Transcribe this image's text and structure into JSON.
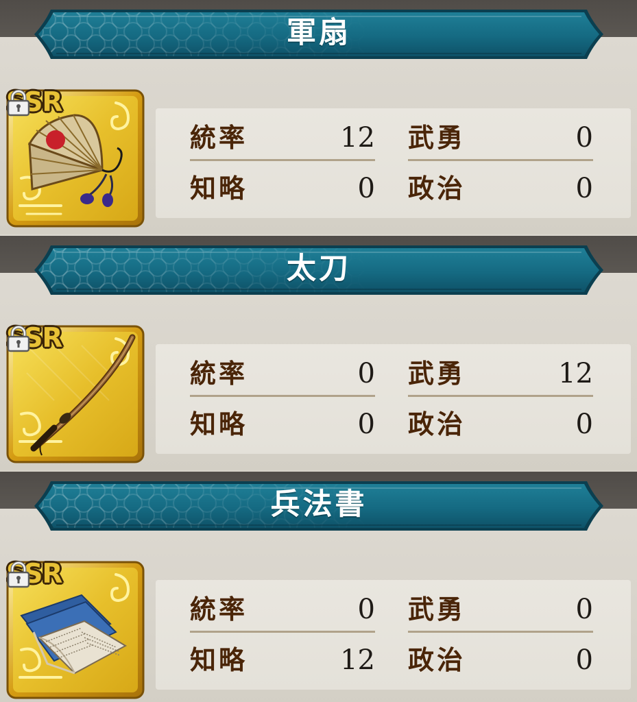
{
  "colors": {
    "banner": "#176f86",
    "banner_dark": "#0d4f64",
    "card_gold": "#e8c431",
    "label_brown": "#4a2508"
  },
  "items": [
    {
      "name": "軍扇",
      "rarity": "SSR",
      "icon": "war-fan-icon",
      "stats": {
        "leadership": {
          "label": "統率",
          "value": "12"
        },
        "valor": {
          "label": "武勇",
          "value": "0"
        },
        "intellect": {
          "label": "知略",
          "value": "0"
        },
        "politics": {
          "label": "政治",
          "value": "0"
        }
      }
    },
    {
      "name": "太刀",
      "rarity": "SSR",
      "icon": "tachi-sword-icon",
      "stats": {
        "leadership": {
          "label": "統率",
          "value": "0"
        },
        "valor": {
          "label": "武勇",
          "value": "12"
        },
        "intellect": {
          "label": "知略",
          "value": "0"
        },
        "politics": {
          "label": "政治",
          "value": "0"
        }
      }
    },
    {
      "name": "兵法書",
      "rarity": "SSR",
      "icon": "strategy-book-icon",
      "stats": {
        "leadership": {
          "label": "統率",
          "value": "0"
        },
        "valor": {
          "label": "武勇",
          "value": "0"
        },
        "intellect": {
          "label": "知略",
          "value": "12"
        },
        "politics": {
          "label": "政治",
          "value": "0"
        }
      }
    }
  ]
}
